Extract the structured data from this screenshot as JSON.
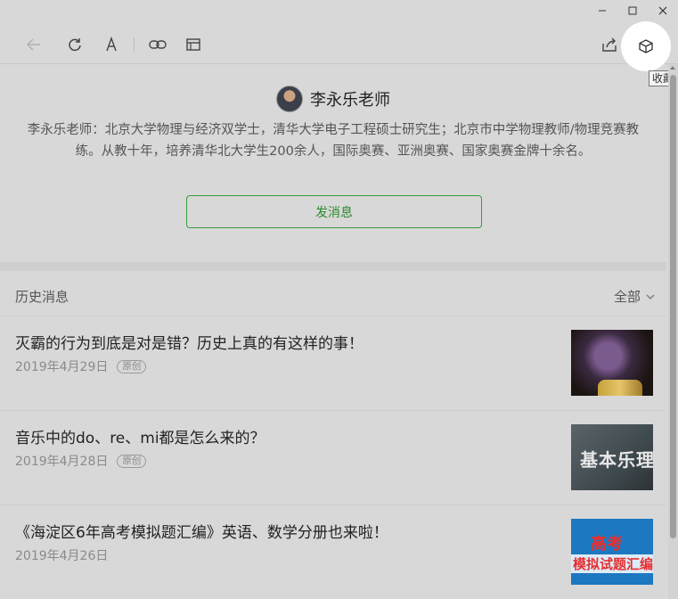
{
  "window": {
    "minimize_glyph": "—",
    "maximize_glyph": "☐",
    "close_glyph": "✕"
  },
  "toolbar": {
    "icons": [
      "back-arrow-icon",
      "refresh-icon",
      "font-size-icon",
      "link-icon",
      "open-in-browser-icon",
      "share-icon",
      "favorite-cube-icon"
    ],
    "tooltip": "收藏"
  },
  "profile": {
    "name": "李永乐老师",
    "bio": "李永乐老师：北京大学物理与经济双学士，清华大学电子工程硕士研究生；北京市中学物理教师/物理竞赛教练。从教十年，培养清华北大学生200余人，国际奥赛、亚洲奥赛、国家奥赛金牌十余名。",
    "send_button": "发消息"
  },
  "history": {
    "title": "历史消息",
    "filter": "全部",
    "articles": [
      {
        "title": "灭霸的行为到底是对是错？历史上真的有这样的事！",
        "date": "2019年4月29日",
        "tag": "原创"
      },
      {
        "title": "音乐中的do、re、mi都是怎么来的？",
        "date": "2019年4月28日",
        "tag": "原创",
        "thumb_text": "基本乐理"
      },
      {
        "title": "《海淀区6年高考模拟题汇编》英语、数学分册也来啦！",
        "date": "2019年4月26日",
        "tag": "",
        "thumb_text_a": "高考",
        "thumb_text_b": "模拟试题汇编"
      }
    ]
  },
  "colors": {
    "accent_green": "#2a8a2a",
    "background": "#d8d8d8"
  }
}
